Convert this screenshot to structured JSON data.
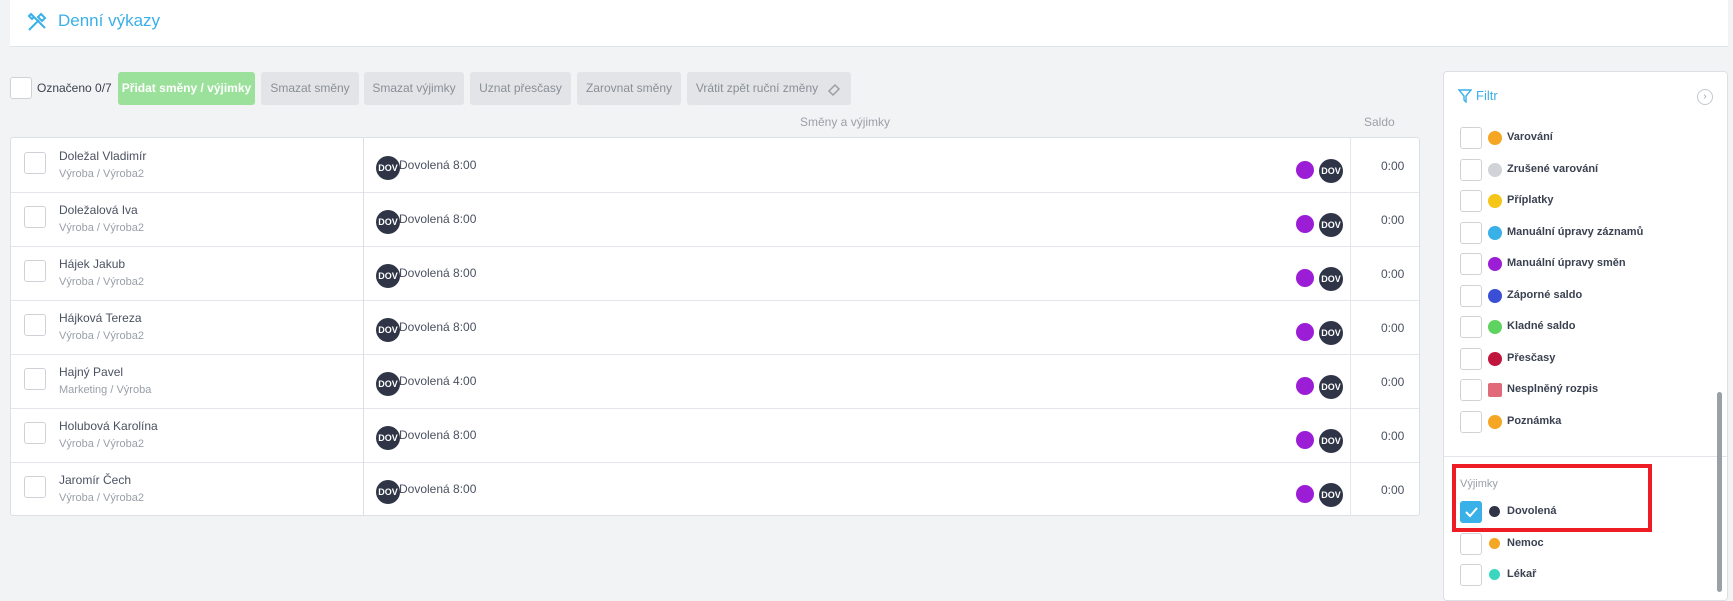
{
  "header": {
    "title": "Denní výkazy"
  },
  "toolbar": {
    "marked": "Označeno 0/7",
    "buttons": [
      "Přidat směny / výjimky",
      "Smazat směny",
      "Smazat výjimky",
      "Uznat přesčasy",
      "Zarovnat směny",
      "Vrátit zpět ruční změny"
    ]
  },
  "columns": {
    "shifts": "Směny a výjimky",
    "saldo": "Saldo"
  },
  "rows": [
    {
      "name": "Doležal Vladimír",
      "dept": "Výroba / Výroba2",
      "badge": "DOV",
      "shift": "Dovolená 8:00",
      "saldo": "0:00"
    },
    {
      "name": "Doležalová Iva",
      "dept": "Výroba / Výroba2",
      "badge": "DOV",
      "shift": "Dovolená 8:00",
      "saldo": "0:00"
    },
    {
      "name": "Hájek Jakub",
      "dept": "Výroba / Výroba2",
      "badge": "DOV",
      "shift": "Dovolená 8:00",
      "saldo": "0:00"
    },
    {
      "name": "Hájková Tereza",
      "dept": "Výroba / Výroba2",
      "badge": "DOV",
      "shift": "Dovolená 8:00",
      "saldo": "0:00"
    },
    {
      "name": "Hajný Pavel",
      "dept": "Marketing / Výroba",
      "badge": "DOV",
      "shift": "Dovolená 4:00",
      "saldo": "0:00"
    },
    {
      "name": "Holubová Karolína",
      "dept": "Výroba / Výroba2",
      "badge": "DOV",
      "shift": "Dovolená 8:00",
      "saldo": "0:00"
    },
    {
      "name": "Jaromír Čech",
      "dept": "Výroba / Výroba2",
      "badge": "DOV",
      "shift": "Dovolená 8:00",
      "saldo": "0:00"
    }
  ],
  "filter": {
    "title": "Filtr",
    "items": [
      {
        "label": "Varování",
        "icon": "warning-icon",
        "color": "#f5a623"
      },
      {
        "label": "Zrušené varování",
        "icon": "cancelled-warning-icon",
        "color": "#d0d3d8"
      },
      {
        "label": "Příplatky",
        "icon": "surcharge-icon",
        "color": "#f5c518"
      },
      {
        "label": "Manuální úpravy záznamů",
        "icon": "record-edit-icon",
        "color": "#3ab0e8"
      },
      {
        "label": "Manuální úpravy směn",
        "icon": "shift-edit-icon",
        "color": "#9b1ed6"
      },
      {
        "label": "Záporné saldo",
        "icon": "negative-balance-icon",
        "color": "#3a4fd6"
      },
      {
        "label": "Kladné saldo",
        "icon": "positive-balance-icon",
        "color": "#5fd35f"
      },
      {
        "label": "Přesčasy",
        "icon": "overtime-icon",
        "color": "#c0163e"
      },
      {
        "label": "Nesplněný rozpis",
        "icon": "unfulfilled-schedule-icon",
        "color": "#e06a7a"
      },
      {
        "label": "Poznámka",
        "icon": "note-icon",
        "color": "#f5a623"
      }
    ],
    "exceptions_title": "Výjimky",
    "exceptions": [
      {
        "label": "Dovolená",
        "color": "#2f3547",
        "checked": true
      },
      {
        "label": "Nemoc",
        "color": "#f5a623",
        "checked": false
      },
      {
        "label": "Lékař",
        "color": "#3ad6c0",
        "checked": false
      }
    ]
  }
}
